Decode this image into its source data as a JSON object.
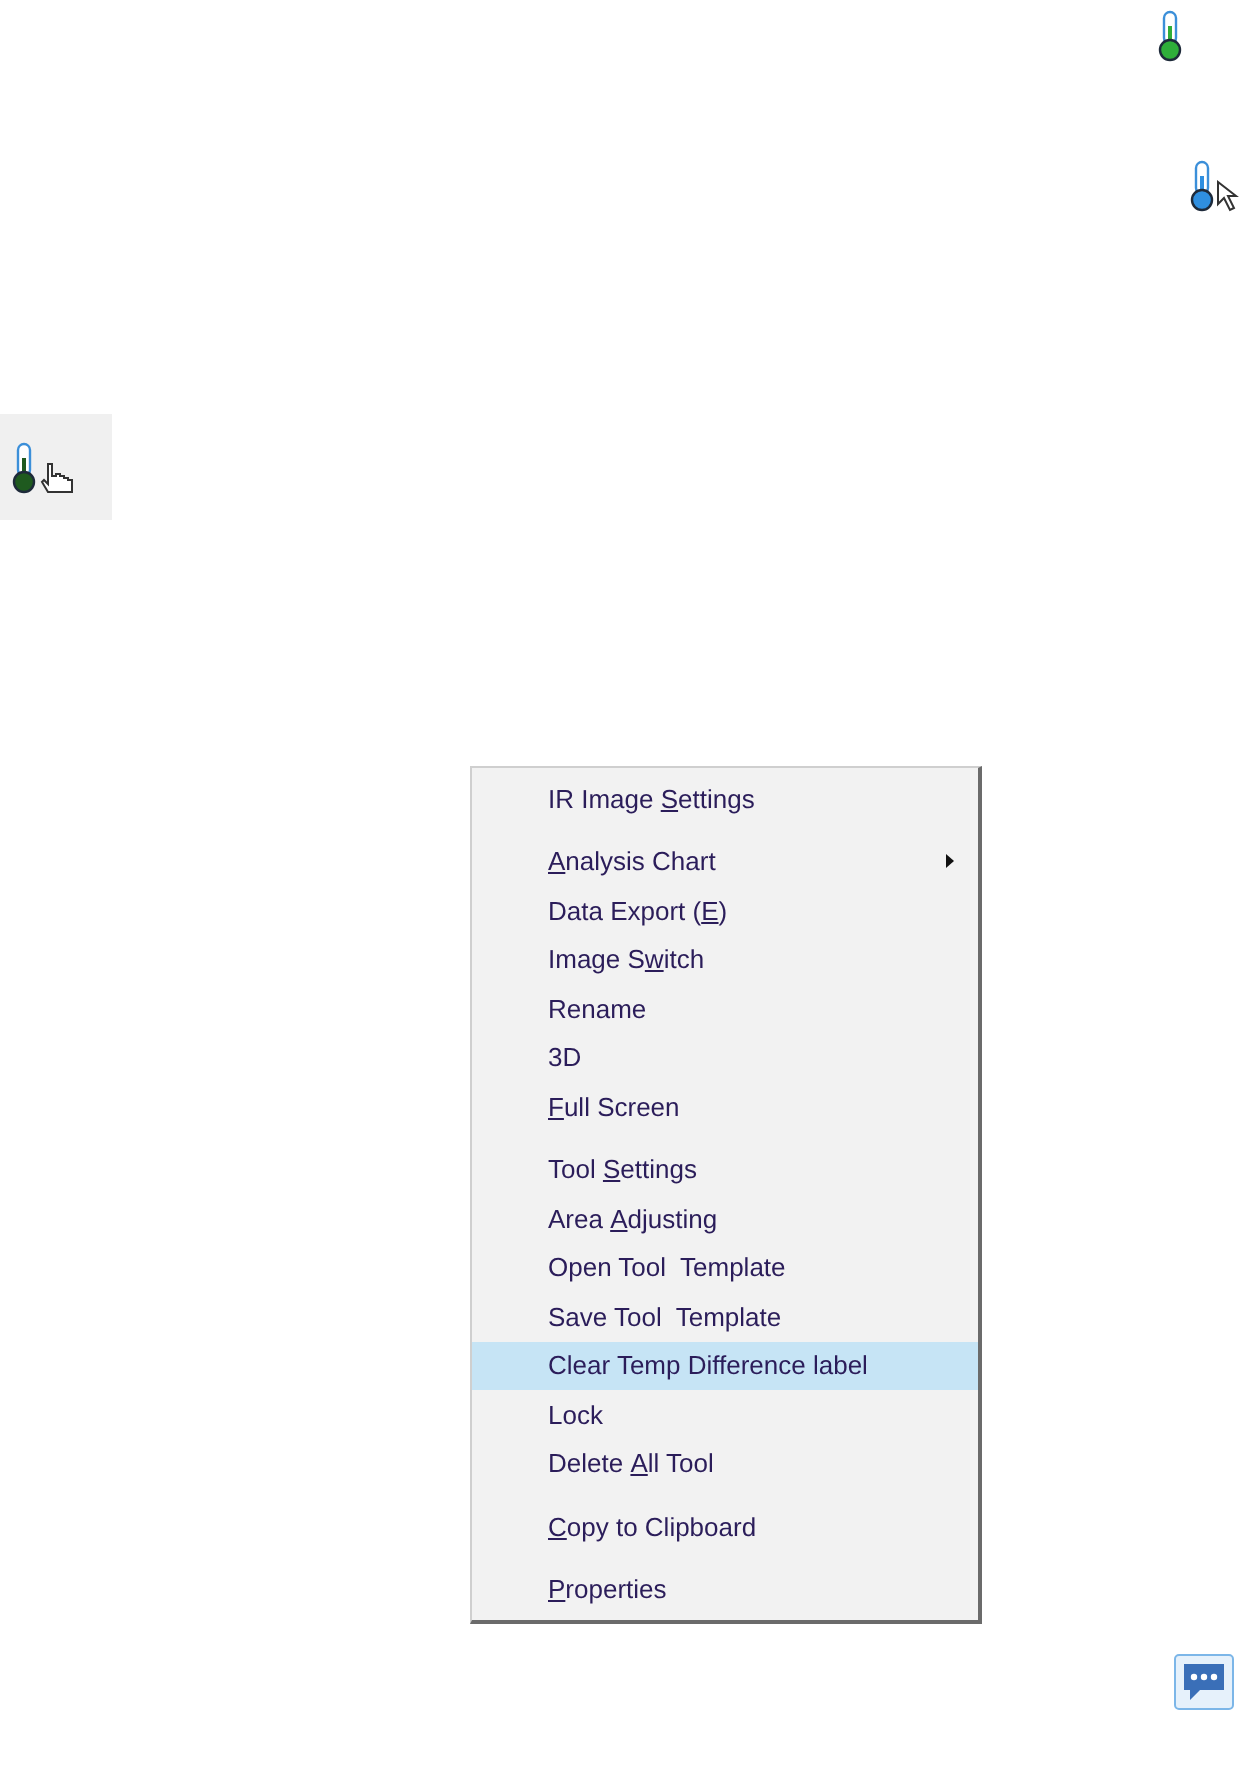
{
  "context_menu": {
    "groups": [
      [
        {
          "before": "IR Image ",
          "key": "S",
          "after": "ettings",
          "has_submenu": false,
          "selected": false
        }
      ],
      [
        {
          "key": "A",
          "after": "nalysis Chart",
          "has_submenu": true,
          "selected": false
        },
        {
          "before": "Data Export (",
          "key": "E",
          "after": ")",
          "has_submenu": false,
          "selected": false
        },
        {
          "before": "Image S",
          "key": "w",
          "after": "itch",
          "has_submenu": false,
          "selected": false
        },
        {
          "before": "Rename",
          "has_submenu": false,
          "selected": false
        },
        {
          "before": "3D",
          "has_submenu": false,
          "selected": false
        },
        {
          "key": "F",
          "after": "ull Screen",
          "has_submenu": false,
          "selected": false
        }
      ],
      [
        {
          "before": "Tool ",
          "key": "S",
          "after": "ettings",
          "has_submenu": false,
          "selected": false
        },
        {
          "before": "Area ",
          "key": "A",
          "after": "djusting",
          "has_submenu": false,
          "selected": false
        },
        {
          "before": "Open Tool  Template",
          "has_submenu": false,
          "selected": false
        },
        {
          "before": "Save Tool  Template",
          "has_submenu": false,
          "selected": false
        },
        {
          "before": "Clear Temp Difference label",
          "has_submenu": false,
          "selected": true
        },
        {
          "before": "Lock",
          "has_submenu": false,
          "selected": false
        },
        {
          "before": "Delete ",
          "key": "A",
          "after": "ll Tool",
          "has_submenu": false,
          "selected": false
        }
      ],
      [
        {
          "key": "C",
          "after": "opy to Clipboard",
          "has_submenu": false,
          "selected": false
        }
      ],
      [
        {
          "key": "P",
          "after": "roperties",
          "has_submenu": false,
          "selected": false
        }
      ]
    ]
  }
}
